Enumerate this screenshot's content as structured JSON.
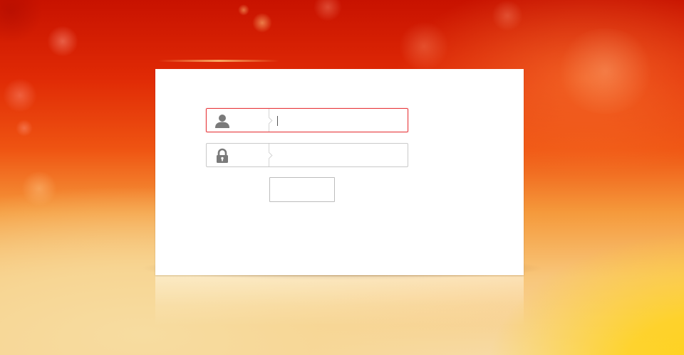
{
  "login_form": {
    "username": {
      "icon": "user-icon",
      "value": "",
      "placeholder": ""
    },
    "password": {
      "icon": "lock-icon",
      "value": "",
      "placeholder": ""
    },
    "submit": {
      "label": ""
    }
  },
  "colors": {
    "focus_border": "#e8393d",
    "field_border": "#c9c9c9",
    "icon": "#7a7a7a",
    "background_top": "#c81200",
    "background_bottom": "#ffd21a"
  }
}
